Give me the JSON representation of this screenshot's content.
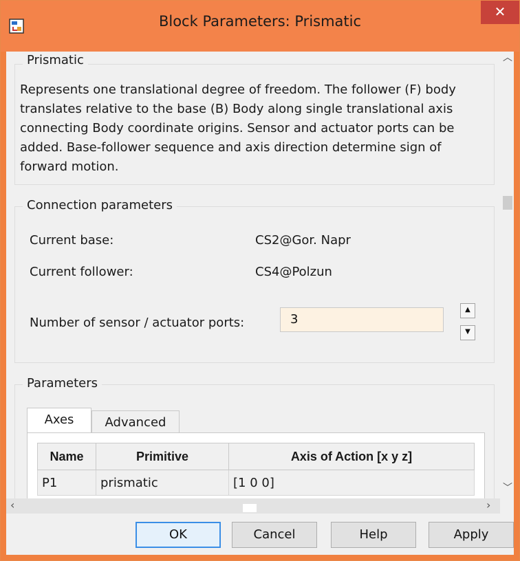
{
  "window": {
    "title": "Block Parameters: Prismatic",
    "close_glyph": "✕"
  },
  "prismatic_group": {
    "legend": "Prismatic",
    "description": "Represents one translational degree of freedom. The follower (F) body translates relative to the base (B) Body along single translational axis connecting Body coordinate origins. Sensor and actuator ports can be added. Base-follower sequence and axis direction determine sign of forward motion."
  },
  "connection": {
    "legend": "Connection parameters",
    "base_label": "Current base:",
    "base_value": "CS2@Gor. Napr",
    "follower_label": "Current follower:",
    "follower_value": "CS4@Polzun",
    "ports_label": "Number of sensor / actuator ports:",
    "ports_value": "3"
  },
  "parameters": {
    "legend": "Parameters",
    "tabs": [
      {
        "label": "Axes",
        "active": true
      },
      {
        "label": "Advanced",
        "active": false
      }
    ],
    "table": {
      "headers": [
        "Name",
        "Primitive",
        "Axis of Action [x y z]"
      ],
      "rows": [
        [
          "P1",
          "prismatic",
          "[1 0 0]"
        ]
      ]
    }
  },
  "buttons": {
    "ok": "OK",
    "cancel": "Cancel",
    "help": "Help",
    "apply": "Apply"
  },
  "colors": {
    "titlebar": "#f3834a",
    "close_button": "#c7423a",
    "input_bg": "#fdf2e2",
    "default_button_border": "#3a8ee6"
  },
  "icons": {
    "app": "simulink-block-icon",
    "close": "close-icon",
    "spin_up": "spin-up-icon",
    "spin_down": "spin-down-icon",
    "scroll_up": "scroll-up-icon",
    "scroll_down": "scroll-down-icon",
    "scroll_left": "scroll-left-icon",
    "scroll_right": "scroll-right-icon"
  }
}
